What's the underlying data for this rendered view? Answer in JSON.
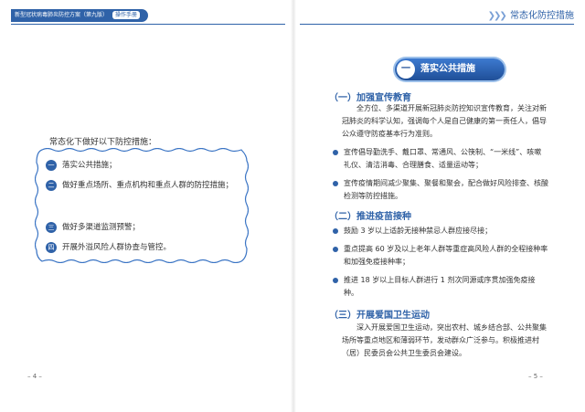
{
  "header": {
    "left_title": "新型冠状病毒肺炎防控方案（第九版）",
    "left_tag": "操作手册",
    "right_title": "常态化防控措施"
  },
  "left_page": {
    "intro": "常态化下做好以下防控措施：",
    "items": [
      {
        "num": "一",
        "text": "落实公共措施；"
      },
      {
        "num": "二",
        "text": "做好重点场所、重点机构和重点人群的防控措施；"
      },
      {
        "num": "三",
        "text": "做好多渠道监测预警；"
      },
      {
        "num": "四",
        "text": "开展外溢风险人群协查与管控。"
      }
    ],
    "page_number": "– 4 –"
  },
  "right_page": {
    "badge_num": "一",
    "badge_text": "落实公共措施",
    "sections": [
      {
        "heading": "（一）加强宣传教育",
        "paragraph": "全方位、多渠道开展新冠肺炎防控知识宣传教育，关注对新冠肺炎的科学认知，强调每个人是自己健康的第一责任人，倡导公众遵守防疫基本行为准则。",
        "bullets": [
          "宣传倡导勤洗手、戴口罩、常通风、公筷制、“一米线”、咳嗽礼仪、清洁消毒、合理膳食、适量运动等；",
          "宣传疫情期间减少聚集、聚餐和聚会，配合做好风险排查、核酸检测等防控措施。"
        ]
      },
      {
        "heading": "（二）推进疫苗接种",
        "bullets": [
          "鼓励 3 岁以上适龄无接种禁忌人群应接尽接；",
          "重点提高 60 岁及以上老年人群等重症高风险人群的全程接种率和加强免疫接种率；",
          "推进 18 岁以上目标人群进行 1 剂次同源或序贯加强免疫接种。"
        ]
      },
      {
        "heading": "（三）开展爱国卫生运动",
        "paragraph": "深入开展爱国卫生运动，突出农村、城乡结合部、公共聚集场所等重点地区和薄弱环节，发动群众广泛参与。积极推进村（居）民委员会公共卫生委员会建设。"
      }
    ],
    "page_number": "– 5 –"
  },
  "colors": {
    "primary": "#2f62a8",
    "border": "#3a74c4"
  }
}
